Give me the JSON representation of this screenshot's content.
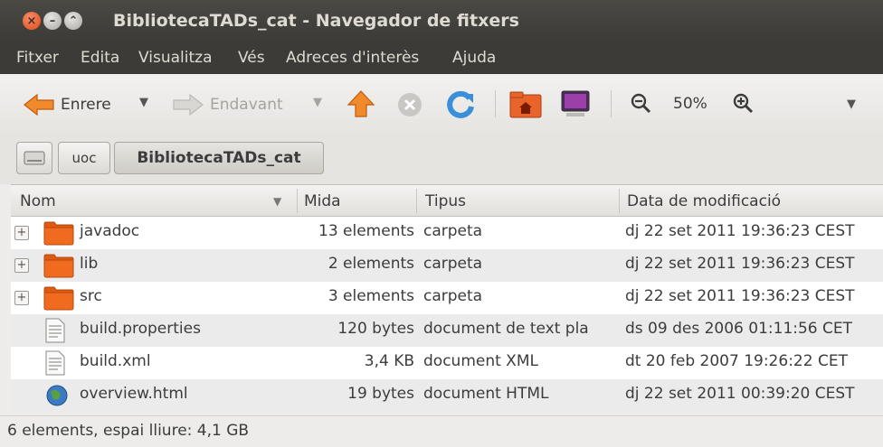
{
  "window": {
    "title": "BibliotecaTADs_cat - Navegador de fitxers"
  },
  "menu": [
    "Fitxer",
    "Edita",
    "Visualitza",
    "Vés",
    "Adreces d'interès",
    "Ajuda"
  ],
  "toolbar": {
    "back_label": "Enrere",
    "forward_label": "Endavant",
    "zoom_level": "50%"
  },
  "breadcrumb": [
    "uoc",
    "BibliotecaTADs_cat"
  ],
  "columns": [
    "Nom",
    "Mida",
    "Tipus",
    "Data de modificació"
  ],
  "files": [
    {
      "name": "javadoc",
      "size": "13 elements",
      "type": "carpeta",
      "date": "dj 22 set 2011 19:36:23 CEST",
      "icon": "folder-icon"
    },
    {
      "name": "lib",
      "size": "2 elements",
      "type": "carpeta",
      "date": "dj 22 set 2011 19:36:23 CEST",
      "icon": "folder-icon"
    },
    {
      "name": "src",
      "size": "3 elements",
      "type": "carpeta",
      "date": "dj 22 set 2011 19:36:23 CEST",
      "icon": "folder-icon"
    },
    {
      "name": "build.properties",
      "size": "120 bytes",
      "type": "document de text pla",
      "date": "ds 09 des 2006 01:11:56 CET",
      "icon": "text-file-icon"
    },
    {
      "name": "build.xml",
      "size": "3,4 KB",
      "type": "document XML",
      "date": "dt 20 feb 2007 19:26:22 CET",
      "icon": "xml-file-icon"
    },
    {
      "name": "overview.html",
      "size": "19 bytes",
      "type": "document HTML",
      "date": "dj 22 set 2011 00:39:20 CEST",
      "icon": "html-file-icon"
    }
  ],
  "status": "6 elements, espai lliure: 4,1 GB",
  "colors": {
    "titlebar": "#3c3b37",
    "close": "#df4b16",
    "folder": "#f06a1f",
    "row_even": "#ffffff",
    "row_odd": "#ebebeb"
  }
}
